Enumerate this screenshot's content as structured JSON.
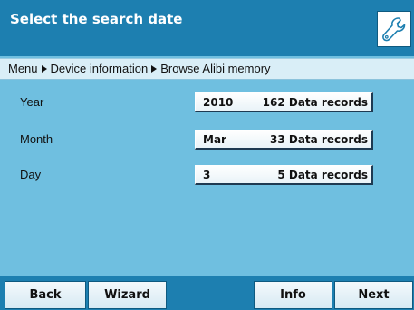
{
  "header": {
    "title": "Select the search date",
    "settings_icon": "wrench-icon"
  },
  "breadcrumb": {
    "items": [
      "Menu",
      "Device information",
      "Browse Alibi memory"
    ]
  },
  "rows": [
    {
      "label": "Year",
      "key": "2010",
      "records": "162 Data records"
    },
    {
      "label": "Month",
      "key": "Mar",
      "records": "33 Data records"
    },
    {
      "label": "Day",
      "key": "3",
      "records": "5 Data records"
    }
  ],
  "footer": {
    "back": "Back",
    "wizard": "Wizard",
    "info": "Info",
    "next": "Next"
  },
  "colors": {
    "title_bar": "#1d7fb0",
    "content_bg": "#6fbfe0",
    "breadcrumb_bg": "#d9eef7"
  }
}
